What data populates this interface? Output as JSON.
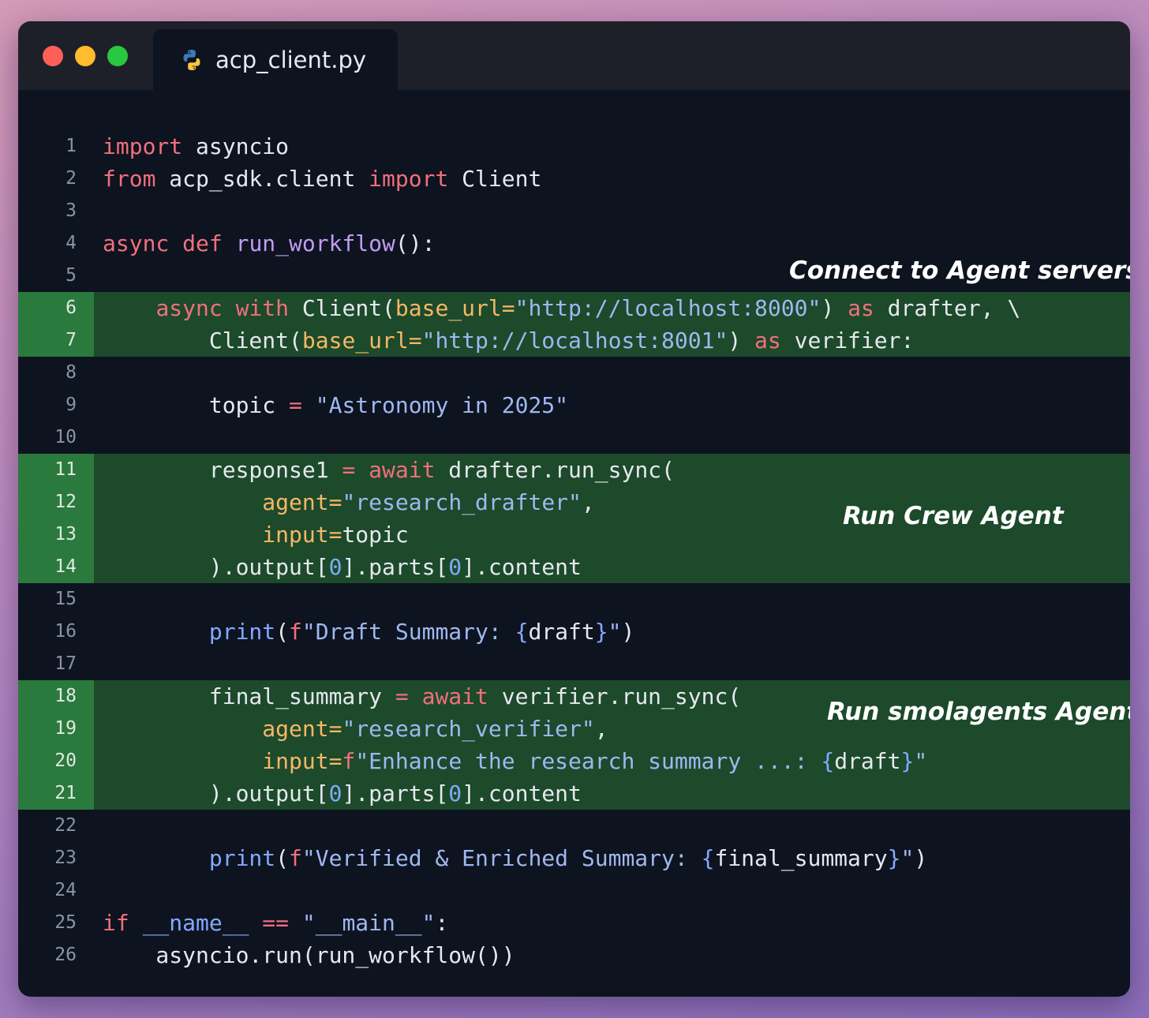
{
  "window": {
    "tab_title": "acp_client.py",
    "tab_icon": "python-icon",
    "traffic_lights": {
      "close": "#fe5f58",
      "minimize": "#febc2e",
      "maximize": "#28c840"
    }
  },
  "annotations": {
    "connect": "Connect to Agent servers",
    "crew": "Run Crew Agent",
    "smol": "Run smolagents Agent"
  },
  "code": {
    "language": "python",
    "highlight_color": "#1c4a2b",
    "lines": [
      {
        "n": "1",
        "hl": false,
        "tokens": [
          [
            "kw",
            "import"
          ],
          [
            "",
            " asyncio"
          ]
        ]
      },
      {
        "n": "2",
        "hl": false,
        "tokens": [
          [
            "kw",
            "from"
          ],
          [
            "",
            " acp_sdk.client "
          ],
          [
            "kw",
            "import"
          ],
          [
            "",
            " Client"
          ]
        ]
      },
      {
        "n": "3",
        "hl": false,
        "tokens": []
      },
      {
        "n": "4",
        "hl": false,
        "tokens": [
          [
            "kw",
            "async"
          ],
          [
            "",
            " "
          ],
          [
            "kw",
            "def"
          ],
          [
            "",
            " "
          ],
          [
            "fn",
            "run_workflow"
          ],
          [
            "",
            "():"
          ]
        ]
      },
      {
        "n": "5",
        "hl": false,
        "tokens": []
      },
      {
        "n": "6",
        "hl": true,
        "tokens": [
          [
            "",
            "    "
          ],
          [
            "kw",
            "async"
          ],
          [
            "",
            " "
          ],
          [
            "kw",
            "with"
          ],
          [
            "",
            " Client("
          ],
          [
            "par",
            "base_url="
          ],
          [
            "str",
            "\"http://localhost:8000\""
          ],
          [
            "",
            ") "
          ],
          [
            "kw",
            "as"
          ],
          [
            "",
            " drafter, \\"
          ]
        ]
      },
      {
        "n": "7",
        "hl": true,
        "tokens": [
          [
            "",
            "        Client("
          ],
          [
            "par",
            "base_url="
          ],
          [
            "str",
            "\"http://localhost:8001\""
          ],
          [
            "",
            ") "
          ],
          [
            "kw",
            "as"
          ],
          [
            "",
            " verifier:"
          ]
        ]
      },
      {
        "n": "8",
        "hl": false,
        "tokens": []
      },
      {
        "n": "9",
        "hl": false,
        "tokens": [
          [
            "",
            "        topic "
          ],
          [
            "op",
            "="
          ],
          [
            "",
            " "
          ],
          [
            "str",
            "\"Astronomy in 2025\""
          ]
        ]
      },
      {
        "n": "10",
        "hl": false,
        "tokens": []
      },
      {
        "n": "11",
        "hl": true,
        "tokens": [
          [
            "",
            "        response1 "
          ],
          [
            "op",
            "="
          ],
          [
            "",
            " "
          ],
          [
            "kw",
            "await"
          ],
          [
            "",
            " drafter.run_sync("
          ]
        ]
      },
      {
        "n": "12",
        "hl": true,
        "tokens": [
          [
            "",
            "            "
          ],
          [
            "par",
            "agent="
          ],
          [
            "str",
            "\"research_drafter\""
          ],
          [
            "",
            ","
          ]
        ]
      },
      {
        "n": "13",
        "hl": true,
        "tokens": [
          [
            "",
            "            "
          ],
          [
            "par",
            "input="
          ],
          [
            "",
            "topic"
          ]
        ]
      },
      {
        "n": "14",
        "hl": true,
        "tokens": [
          [
            "",
            "        ).output["
          ],
          [
            "num",
            "0"
          ],
          [
            "",
            "].parts["
          ],
          [
            "num",
            "0"
          ],
          [
            "",
            "].content"
          ]
        ]
      },
      {
        "n": "15",
        "hl": false,
        "tokens": []
      },
      {
        "n": "16",
        "hl": false,
        "tokens": [
          [
            "",
            "        "
          ],
          [
            "bi",
            "print"
          ],
          [
            "",
            "("
          ],
          [
            "kw",
            "f"
          ],
          [
            "str",
            "\"Draft Summary: "
          ],
          [
            "bi",
            "{"
          ],
          [
            "",
            "draft"
          ],
          [
            "bi",
            "}"
          ],
          [
            "str",
            "\""
          ],
          [
            "",
            ")"
          ]
        ]
      },
      {
        "n": "17",
        "hl": false,
        "tokens": []
      },
      {
        "n": "18",
        "hl": true,
        "tokens": [
          [
            "",
            "        final_summary "
          ],
          [
            "op",
            "="
          ],
          [
            "",
            " "
          ],
          [
            "kw",
            "await"
          ],
          [
            "",
            " verifier.run_sync("
          ]
        ]
      },
      {
        "n": "19",
        "hl": true,
        "tokens": [
          [
            "",
            "            "
          ],
          [
            "par",
            "agent="
          ],
          [
            "str",
            "\"research_verifier\""
          ],
          [
            "",
            ","
          ]
        ]
      },
      {
        "n": "20",
        "hl": true,
        "tokens": [
          [
            "",
            "            "
          ],
          [
            "par",
            "input="
          ],
          [
            "kw",
            "f"
          ],
          [
            "str",
            "\"Enhance the research summary ...: "
          ],
          [
            "bi",
            "{"
          ],
          [
            "",
            "draft"
          ],
          [
            "bi",
            "}"
          ],
          [
            "str",
            "\""
          ]
        ]
      },
      {
        "n": "21",
        "hl": true,
        "tokens": [
          [
            "",
            "        ).output["
          ],
          [
            "num",
            "0"
          ],
          [
            "",
            "].parts["
          ],
          [
            "num",
            "0"
          ],
          [
            "",
            "].content"
          ]
        ]
      },
      {
        "n": "22",
        "hl": false,
        "tokens": []
      },
      {
        "n": "23",
        "hl": false,
        "tokens": [
          [
            "",
            "        "
          ],
          [
            "bi",
            "print"
          ],
          [
            "",
            "("
          ],
          [
            "kw",
            "f"
          ],
          [
            "str",
            "\"Verified & Enriched Summary: "
          ],
          [
            "bi",
            "{"
          ],
          [
            "",
            "final_summary"
          ],
          [
            "bi",
            "}"
          ],
          [
            "str",
            "\""
          ],
          [
            "",
            ")"
          ]
        ]
      },
      {
        "n": "24",
        "hl": false,
        "tokens": []
      },
      {
        "n": "25",
        "hl": false,
        "tokens": [
          [
            "kw",
            "if"
          ],
          [
            "",
            " "
          ],
          [
            "bi",
            "__name__"
          ],
          [
            "",
            " "
          ],
          [
            "op",
            "=="
          ],
          [
            "",
            " "
          ],
          [
            "str",
            "\"__main__\""
          ],
          [
            "",
            ":"
          ]
        ]
      },
      {
        "n": "26",
        "hl": false,
        "tokens": [
          [
            "",
            "    asyncio.run(run_workflow())"
          ]
        ]
      }
    ]
  }
}
